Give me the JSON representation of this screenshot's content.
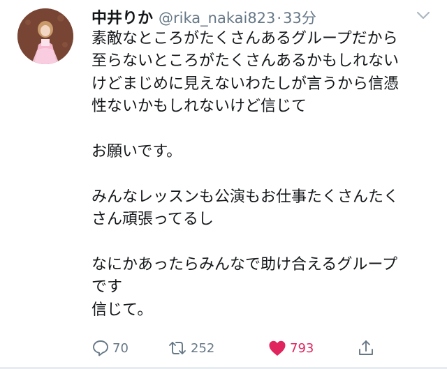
{
  "user": {
    "display_name": "中井りか",
    "handle": "@rika_nakai823",
    "separator": "·",
    "time": "33分"
  },
  "tweet": {
    "lines": [
      "素敵なところがたくさんあるグループだから",
      "至らないところがたくさんあるかもしれない",
      "けどまじめに見えないわたしが言うから信憑",
      "性ないかもしれないけど信じて",
      "",
      "お願いです。",
      "",
      "みんなレッスンも公演もお仕事たくさんたく",
      "さん頑張ってるし",
      "",
      "なにかあったらみんなで助け合えるグループ",
      "です",
      "信じて。"
    ]
  },
  "actions": {
    "reply_count": "70",
    "retweet_count": "252",
    "like_count": "793"
  },
  "colors": {
    "secondary_text": "#657786",
    "like_red": "#e0245e",
    "primary_text": "#14171a"
  },
  "icons": [
    "chevron-down-icon",
    "reply-icon",
    "retweet-icon",
    "heart-icon",
    "share-icon"
  ]
}
